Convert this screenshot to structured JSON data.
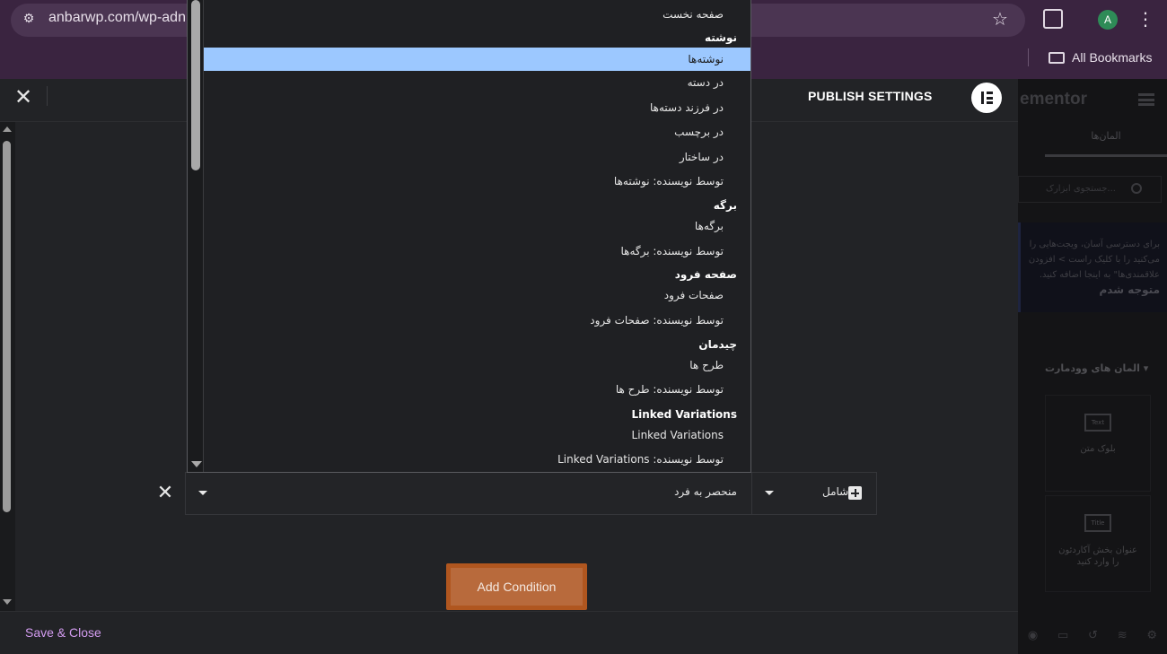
{
  "browser": {
    "url": "anbarwp.com/wp-adn",
    "bookmarks_label": "All Bookmarks",
    "avatar_letter": "A"
  },
  "modal": {
    "title": "PUBLISH SETTINGS",
    "condition": {
      "type_value": "شامل",
      "sub_value": "منحصر به فرد"
    },
    "add_condition_label": "Add Condition",
    "save_close_label": "Save & Close"
  },
  "dropdown": {
    "items": [
      {
        "kind": "option",
        "label": "صفحه نخست"
      },
      {
        "kind": "group",
        "label": "نوشته"
      },
      {
        "kind": "option",
        "label": "نوشته‌ها",
        "selected": true
      },
      {
        "kind": "option",
        "label": "در دسته"
      },
      {
        "kind": "option",
        "label": "در فرزند دسته‌ها"
      },
      {
        "kind": "option",
        "label": "در برچسب"
      },
      {
        "kind": "option",
        "label": "در ساختار"
      },
      {
        "kind": "option",
        "label": "توسط نویسنده: نوشته‌ها"
      },
      {
        "kind": "group",
        "label": "برگه"
      },
      {
        "kind": "option",
        "label": "برگه‌ها"
      },
      {
        "kind": "option",
        "label": "توسط نویسنده: برگه‌ها"
      },
      {
        "kind": "group",
        "label": "صفحه فرود"
      },
      {
        "kind": "option",
        "label": "صفحات فرود"
      },
      {
        "kind": "option",
        "label": "توسط نویسنده: صفحات فرود"
      },
      {
        "kind": "group",
        "label": "چیدمان"
      },
      {
        "kind": "option",
        "label": "طرح ها"
      },
      {
        "kind": "option",
        "label": "توسط نویسنده: طرح ها"
      },
      {
        "kind": "group",
        "label": "Linked Variations"
      },
      {
        "kind": "option",
        "label": "Linked Variations"
      },
      {
        "kind": "option",
        "label": "توسط نویسنده: Linked Variations"
      }
    ]
  },
  "side_panel": {
    "logo_text": "ementor",
    "tab_label": "المان‌ها",
    "search_placeholder": "جستجوی ابزارک...",
    "note_lines": [
      "برای دسترسی آسان، ویجت‌هایی را",
      "می‌کنید را با کلیک راست > افزودن",
      "علاقمندی‌ها\" به اینجا اضافه کنید."
    ],
    "note_link": "متوجه شدم",
    "section_label": "المان های وودمارت",
    "widgets": [
      {
        "icon_text": "Text",
        "label": "بلوک متن"
      },
      {
        "icon_text": "Title",
        "label": "عنوان بخش آکاردئون را وارد کنید"
      }
    ]
  }
}
